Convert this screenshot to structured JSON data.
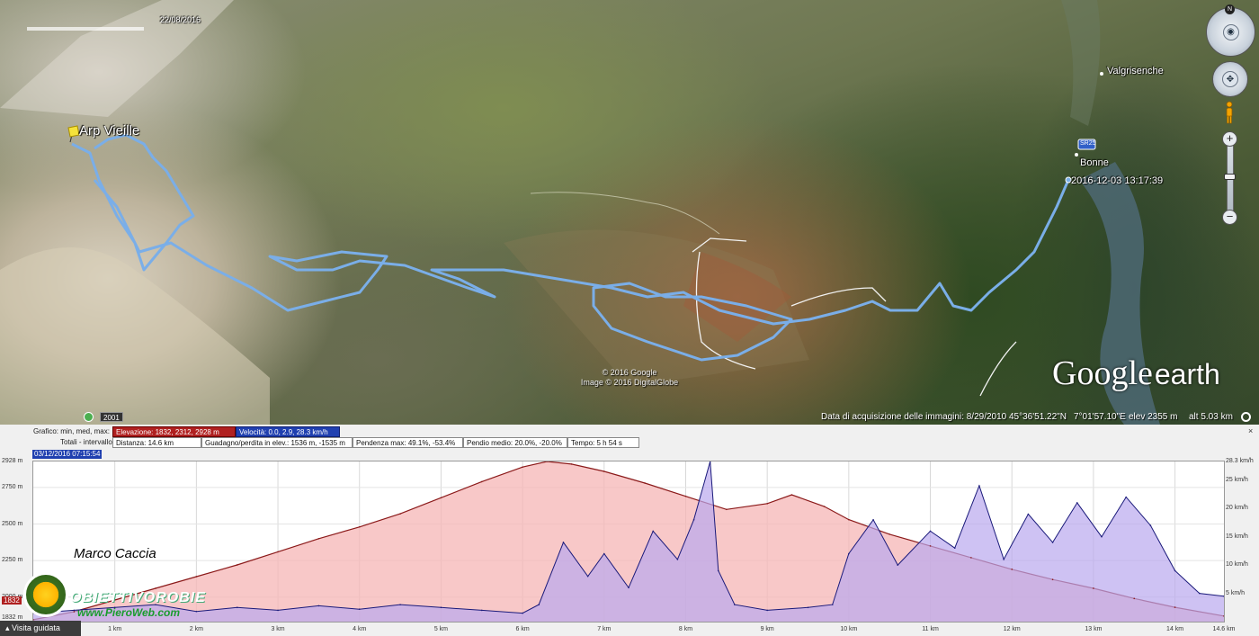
{
  "map": {
    "top_date": "22/08/2016",
    "place_start": "Arp Vieille",
    "place_valgrisenche": "Valgrisenche",
    "place_bonne": "Bonne",
    "road_label": "SR25",
    "track_timestamp": "2016-12-03 13:17:39",
    "copyright_1": "© 2016 Google",
    "copyright_2": "Image © 2016 DigitalGlobe",
    "year_badge": "2001",
    "status": {
      "acquisition": "Data di acquisizione delle immagini: 8/29/2010",
      "lat": "45°36'51.22\"N",
      "lon": "7°01'57.10\"E",
      "elev": "elev  2355 m",
      "alt": "alt   5.03 km"
    },
    "logo_google": "Google",
    "logo_earth": "earth",
    "compass_n": "N",
    "zoom_plus": "+",
    "zoom_minus": "−",
    "track_color": "#7aaee8"
  },
  "profile": {
    "graph_label": "Grafico: min, med, max:",
    "elevation": "Elevazione: 1832, 2312, 2928 m",
    "speed": "Velocità: 0.0, 2.9, 28.3 km/h",
    "totals_label": "Totali - intervallo:",
    "distance": "Distanza: 14.6 km",
    "gain_loss": "Guadagno/perdita in elev.: 1536 m, -1535 m",
    "max_slope": "Pendenza max: 49.1%, -53.4%",
    "avg_slope": "Pendio medio: 20.0%, -20.0%",
    "time": "Tempo: 5 h 54 s",
    "cursor_time": "03/12/2016 07:15:54",
    "close": "×",
    "author": "Marco Caccia",
    "logo_text": "OBIETTIVOROBIE",
    "logo_url": "www.PieroWeb.com",
    "marker_value": "1832",
    "guided_tour": "Visita guidata",
    "elevation_color": "#8b1a1a",
    "elevation_fill": "#f6b5b5",
    "speed_color": "#1a1a7a",
    "speed_fill": "#b9a8ee"
  },
  "chart_data": {
    "type": "area",
    "x_unit": "km",
    "xlim": [
      0,
      14.6
    ],
    "x_ticks": [
      "1 km",
      "2 km",
      "3 km",
      "4 km",
      "5 km",
      "6 km",
      "7 km",
      "8 km",
      "9 km",
      "10 km",
      "11 km",
      "12 km",
      "13 km",
      "14 km",
      "14.6 km"
    ],
    "y_left_ticks": [
      "2928 m",
      "2750 m",
      "2500 m",
      "2250 m",
      "2000 m",
      "1832 m"
    ],
    "y_right_ticks": [
      "28.3 km/h",
      "25 km/h",
      "20 km/h",
      "15 km/h",
      "10 km/h",
      "5 km/h"
    ],
    "ylim_elevation": [
      1832,
      2928
    ],
    "ylim_speed": [
      0,
      28.3
    ],
    "series": [
      {
        "name": "Elevazione",
        "axis": "left",
        "x": [
          0,
          0.5,
          1,
          1.5,
          2,
          2.5,
          3,
          3.5,
          4,
          4.5,
          5,
          5.5,
          6,
          6.3,
          6.6,
          7,
          7.5,
          8,
          8.5,
          9,
          9.3,
          9.7,
          10,
          10.5,
          11,
          11.5,
          12,
          12.5,
          13,
          13.5,
          14,
          14.6
        ],
        "y": [
          1845,
          1900,
          1980,
          2060,
          2140,
          2220,
          2310,
          2400,
          2480,
          2570,
          2680,
          2790,
          2890,
          2928,
          2910,
          2860,
          2780,
          2690,
          2600,
          2640,
          2700,
          2620,
          2530,
          2430,
          2350,
          2270,
          2190,
          2120,
          2060,
          1990,
          1930,
          1870
        ]
      },
      {
        "name": "Velocità",
        "axis": "right",
        "x": [
          0,
          0.5,
          1,
          1.5,
          2,
          2.5,
          3,
          3.5,
          4,
          4.5,
          5,
          5.5,
          6,
          6.2,
          6.5,
          6.8,
          7,
          7.3,
          7.6,
          7.9,
          8.1,
          8.3,
          8.4,
          8.6,
          9,
          9.5,
          9.8,
          10,
          10.3,
          10.6,
          11,
          11.3,
          11.6,
          11.9,
          12.2,
          12.5,
          12.8,
          13.1,
          13.4,
          13.7,
          14,
          14.3,
          14.6
        ],
        "y": [
          1.5,
          2,
          2.5,
          3,
          1.8,
          2.5,
          2,
          2.8,
          2.2,
          3,
          2.5,
          2,
          1.5,
          3,
          14,
          8,
          12,
          6,
          16,
          11,
          18,
          28.3,
          9,
          3,
          2,
          2.5,
          3,
          12,
          18,
          10,
          16,
          13,
          24,
          11,
          19,
          14,
          21,
          15,
          22,
          17,
          9,
          5,
          4.5
        ]
      }
    ]
  }
}
